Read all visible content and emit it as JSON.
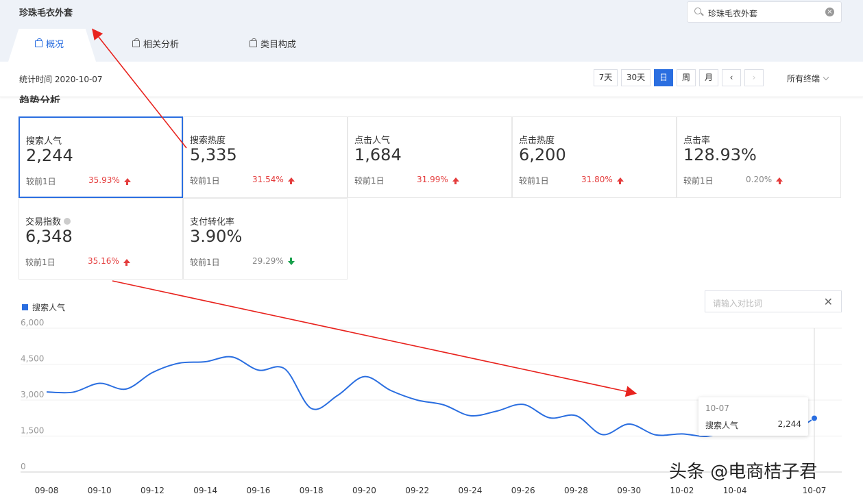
{
  "header": {
    "keyword": "珍珠毛衣外套",
    "search": {
      "value": "珍珠毛衣外套",
      "icon": "search-icon",
      "clear_icon": "clear-icon"
    }
  },
  "tabs": [
    {
      "label": "概况",
      "active": true,
      "icon": "bag-icon"
    },
    {
      "label": "相关分析",
      "active": false,
      "icon": "bag-icon"
    },
    {
      "label": "类目构成",
      "active": false,
      "icon": "bag-icon"
    }
  ],
  "statbar": {
    "stat_time": "统计时间 2020-10-07",
    "range_buttons": [
      {
        "label": "7天",
        "active": false
      },
      {
        "label": "30天",
        "active": false
      },
      {
        "label": "日",
        "active": true
      },
      {
        "label": "周",
        "active": false
      },
      {
        "label": "月",
        "active": false
      }
    ],
    "prev_label": "‹",
    "next_label": "›",
    "terminal": "所有终端"
  },
  "section_title": "趋势分析",
  "metrics": [
    {
      "label": "搜索人气",
      "value": "2,244",
      "compare": "较前1日",
      "change": "35.93%",
      "trend": "up",
      "selected": true
    },
    {
      "label": "搜索热度",
      "value": "5,335",
      "compare": "较前1日",
      "change": "31.54%",
      "trend": "up"
    },
    {
      "label": "点击人气",
      "value": "1,684",
      "compare": "较前1日",
      "change": "31.99%",
      "trend": "up"
    },
    {
      "label": "点击热度",
      "value": "6,200",
      "compare": "较前1日",
      "change": "31.80%",
      "trend": "up"
    },
    {
      "label": "点击率",
      "value": "128.93%",
      "compare": "较前1日",
      "change": "0.20%",
      "trend": "up",
      "muted": true
    },
    {
      "label": "交易指数",
      "value": "6,348",
      "compare": "较前1日",
      "change": "35.16%",
      "trend": "up",
      "info": true
    },
    {
      "label": "支付转化率",
      "value": "3.90%",
      "compare": "较前1日",
      "change": "29.29%",
      "trend": "down",
      "muted": true
    }
  ],
  "chart_area": {
    "legend": "搜索人气",
    "compare_placeholder": "请输入对比词",
    "tooltip": {
      "date": "10-07",
      "name": "搜索人气",
      "value": "2,244"
    }
  },
  "chart_data": {
    "type": "line",
    "ylim": [
      0,
      6000
    ],
    "yticks": [
      "6,000",
      "4,500",
      "3,000",
      "1,500",
      "0"
    ],
    "ytick_values": [
      6000,
      4500,
      3000,
      1500,
      0
    ],
    "xtick_labels": [
      "09-08",
      "09-10",
      "09-12",
      "09-14",
      "09-16",
      "09-18",
      "09-20",
      "09-22",
      "09-24",
      "09-26",
      "09-28",
      "09-30",
      "10-02",
      "10-04",
      "10-07"
    ],
    "series": [
      {
        "name": "搜索人气",
        "color": "#2a6ee0",
        "x": [
          "09-08",
          "09-09",
          "09-10",
          "09-11",
          "09-12",
          "09-13",
          "09-14",
          "09-15",
          "09-16",
          "09-17",
          "09-18",
          "09-19",
          "09-20",
          "09-21",
          "09-22",
          "09-23",
          "09-24",
          "09-25",
          "09-26",
          "09-27",
          "09-28",
          "09-29",
          "09-30",
          "10-01",
          "10-02",
          "10-03",
          "10-04",
          "10-05",
          "10-06",
          "10-07"
        ],
        "values": [
          3340,
          3330,
          3700,
          3460,
          4150,
          4540,
          4600,
          4800,
          4250,
          4300,
          2650,
          3200,
          3980,
          3400,
          3000,
          2800,
          2350,
          2540,
          2820,
          2260,
          2350,
          1560,
          2000,
          1550,
          1590,
          1500,
          1900,
          2060,
          1650,
          2244
        ]
      }
    ]
  },
  "watermark": "头条 @电商桔子君",
  "annotation_colors": {
    "arrow": "#e8231e"
  }
}
